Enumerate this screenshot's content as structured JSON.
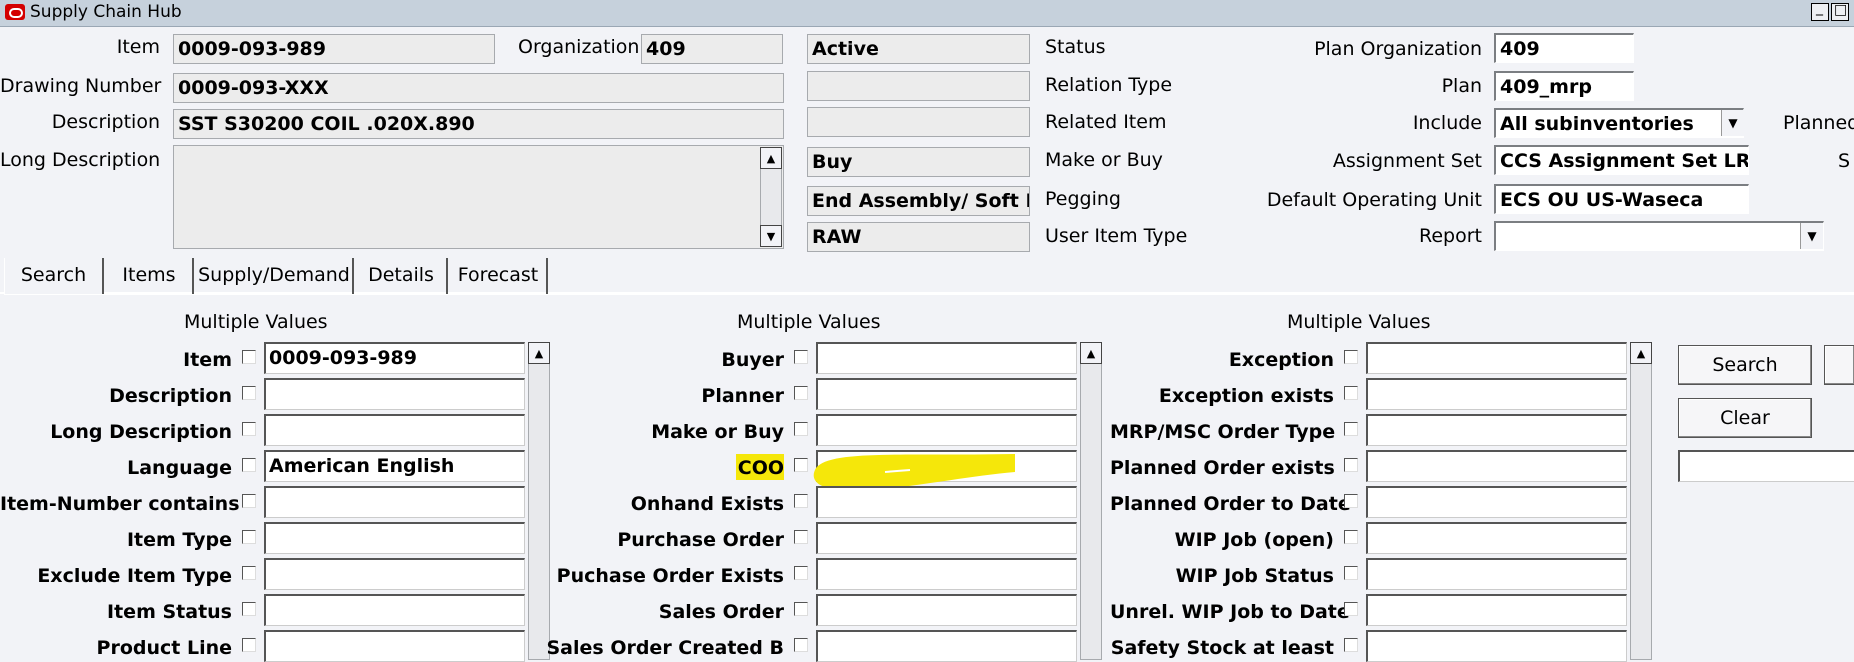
{
  "window": {
    "title": "Supply Chain Hub",
    "minimize_glyph": "_",
    "maximize_glyph": "□"
  },
  "header": {
    "item_label": "Item",
    "item_value": "0009-093-989",
    "org_label": "Organization",
    "org_value": "409",
    "drawing_label": "Drawing Number",
    "drawing_value": "0009-093-XXX",
    "desc_label": "Description",
    "desc_value": "SST S30200 COIL .020X.890",
    "longdesc_label": "Long Description",
    "longdesc_value": "",
    "mid_values": [
      "Active",
      "",
      "",
      "Buy",
      "End Assembly/ Soft Peg",
      "RAW"
    ],
    "mid_labels": [
      "Status",
      "Relation Type",
      "Related Item",
      "Make or Buy",
      "Pegging",
      "User Item Type"
    ],
    "right_labels": [
      "Plan Organization",
      "Plan",
      "Include",
      "Assignment Set",
      "Default Operating Unit",
      "Report"
    ],
    "right_values": [
      "409",
      "409_mrp",
      "All subinventories",
      "CCS Assignment Set LRGV",
      "ECS OU US-Waseca",
      ""
    ],
    "far_right_labels": [
      "Planned",
      "S"
    ]
  },
  "tabs": [
    "Search",
    "Items",
    "Supply/Demand",
    "Details",
    "Forecast"
  ],
  "search": {
    "multiple_values_label": "Multiple Values",
    "col1": [
      {
        "label": "Item",
        "value": "0009-093-989"
      },
      {
        "label": "Description",
        "value": ""
      },
      {
        "label": "Long Description",
        "value": ""
      },
      {
        "label": "Language",
        "value": "American English"
      },
      {
        "label": "Item-Number contains",
        "value": ""
      },
      {
        "label": "Item Type",
        "value": ""
      },
      {
        "label": "Exclude Item Type",
        "value": ""
      },
      {
        "label": "Item Status",
        "value": ""
      },
      {
        "label": "Product Line",
        "value": ""
      }
    ],
    "col2": [
      {
        "label": "Buyer",
        "value": ""
      },
      {
        "label": "Planner",
        "value": ""
      },
      {
        "label": "Make or Buy",
        "value": ""
      },
      {
        "label": "COO",
        "value": ""
      },
      {
        "label": "Onhand Exists",
        "value": ""
      },
      {
        "label": "Purchase Order",
        "value": ""
      },
      {
        "label": "Puchase Order Exists",
        "value": ""
      },
      {
        "label": "Sales Order",
        "value": ""
      },
      {
        "label": "Sales Order Created B",
        "value": ""
      }
    ],
    "col3": [
      {
        "label": "Exception",
        "value": ""
      },
      {
        "label": "Exception exists",
        "value": ""
      },
      {
        "label": "MRP/MSC Order Type",
        "value": ""
      },
      {
        "label": "Planned Order exists",
        "value": ""
      },
      {
        "label": "Planned Order to Date",
        "value": ""
      },
      {
        "label": "WIP Job (open)",
        "value": ""
      },
      {
        "label": "WIP Job Status",
        "value": ""
      },
      {
        "label": "Unrel. WIP Job to Date",
        "value": ""
      },
      {
        "label": "Safety Stock at least",
        "value": ""
      }
    ],
    "search_button": "Search",
    "clear_button": "Clear",
    "highlight_color": "#f5e70a"
  }
}
